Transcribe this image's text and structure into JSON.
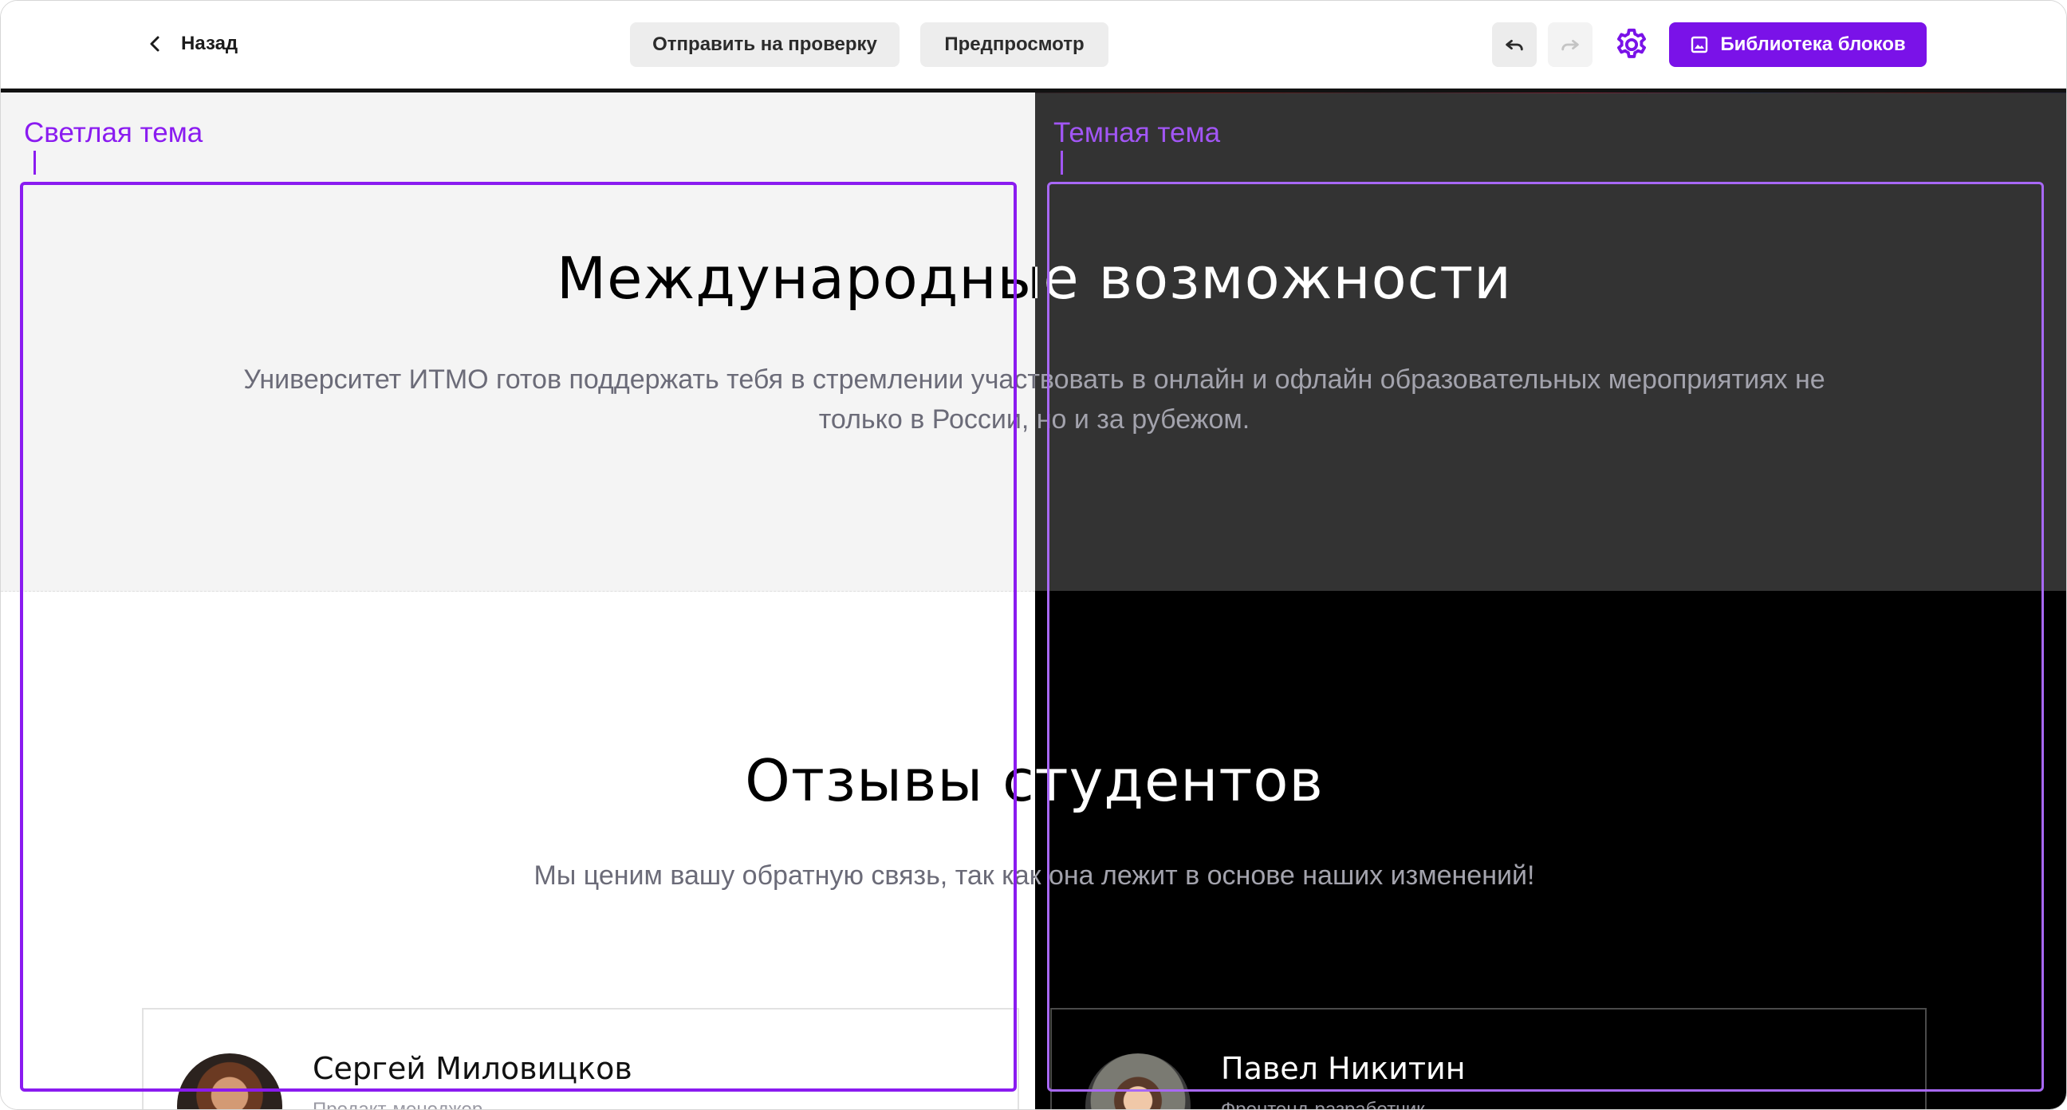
{
  "topbar": {
    "back_label": "Назад",
    "submit_label": "Отправить на проверку",
    "preview_label": "Предпросмотр",
    "library_label": "Библиотека блоков",
    "accent_color": "#7a12e8"
  },
  "themes": {
    "light_label": "Светлая тема",
    "dark_label": "Темная тема"
  },
  "section_opportunities": {
    "title": "Международные возможности",
    "lead_line1": "Университет ИТМО готов поддержать тебя в стремлении участвовать в онлайн и офлайн образовательных мероприятиях не",
    "lead_line2": "только в России, но и за рубежом."
  },
  "section_reviews": {
    "title": "Отзывы студентов",
    "subtitle": "Мы ценим вашу обратную связь, так как она лежит в основе наших изменений!",
    "cards": [
      {
        "name": "Сергей Миловицков",
        "role": "Продакт-менеджер"
      },
      {
        "name": "Павел Никитин",
        "role": "Фронтенд-разработчик"
      }
    ]
  }
}
